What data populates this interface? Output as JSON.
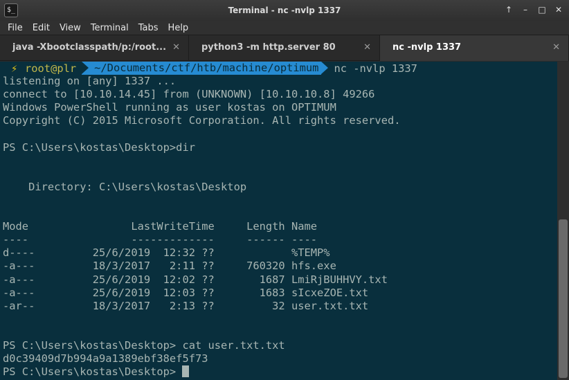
{
  "window": {
    "title": "Terminal - nc -nvlp 1337",
    "icon_glyph": "$_",
    "controls": [
      "↑",
      "–",
      "□",
      "✕"
    ]
  },
  "menu": [
    "File",
    "Edit",
    "View",
    "Terminal",
    "Tabs",
    "Help"
  ],
  "tabs": [
    {
      "label": "java -Xbootclasspath/p:/root...",
      "close": "✕"
    },
    {
      "label": "python3 -m http.server 80",
      "close": "✕"
    },
    {
      "label": "nc -nvlp 1337",
      "close": "✕",
      "active": true
    }
  ],
  "terminal": {
    "prompt": {
      "bolt": "⚡",
      "user": "root@plr",
      "path": "~/Documents/ctf/htb/machine/optimum",
      "command": "nc -nvlp 1337"
    },
    "lines": [
      "listening on [any] 1337 ...",
      "connect to [10.10.14.45] from (UNKNOWN) [10.10.10.8] 49266",
      "Windows PowerShell running as user kostas on OPTIMUM",
      "Copyright (C) 2015 Microsoft Corporation. All rights reserved.",
      "",
      "PS C:\\Users\\kostas\\Desktop>dir",
      "",
      "",
      "    Directory: C:\\Users\\kostas\\Desktop",
      "",
      "",
      "Mode                LastWriteTime     Length Name",
      "----                -------------     ------ ----",
      "d----         25/6/2019  12:32 ??            %TEMP%",
      "-a---         18/3/2017   2:11 ??     760320 hfs.exe",
      "-a---         25/6/2019  12:02 ??       1687 LmiRjBUHHVY.txt",
      "-a---         25/6/2019  12:03 ??       1683 sIcxeZOE.txt",
      "-ar--         18/3/2017   2:13 ??         32 user.txt.txt",
      "",
      "",
      "PS C:\\Users\\kostas\\Desktop> cat user.txt.txt",
      "d0c39409d7b994a9a1389ebf38ef5f73"
    ],
    "last_prompt": "PS C:\\Users\\kostas\\Desktop> "
  }
}
